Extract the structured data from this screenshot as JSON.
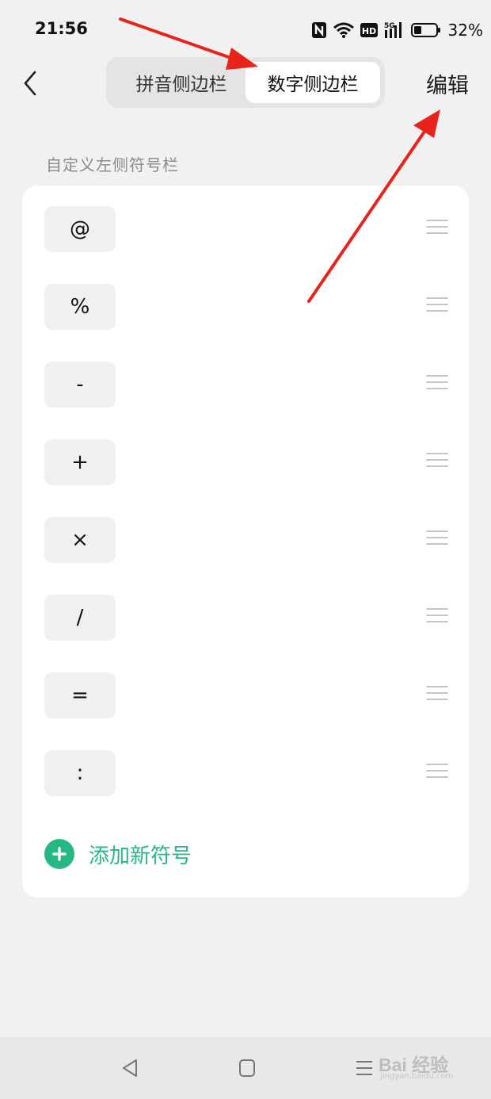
{
  "status_bar": {
    "time": "21:56",
    "battery": "32%",
    "icons": [
      "nfc-icon",
      "wifi-icon",
      "hd-icon",
      "signal-5g-icon",
      "battery-icon"
    ],
    "signal_label": "5G",
    "hd_label": "HD"
  },
  "header": {
    "tabs": [
      {
        "label": "拼音侧边栏",
        "selected": false
      },
      {
        "label": "数字侧边栏",
        "selected": true
      }
    ],
    "edit_label": "编辑"
  },
  "section_title": "自定义左侧符号栏",
  "symbols": [
    "@",
    "%",
    "-",
    "+",
    "×",
    "/",
    "=",
    ":"
  ],
  "add_symbol_label": "添加新符号",
  "watermark": {
    "text": "Bai 经验",
    "sub": "jingyan.baidu.com"
  },
  "colors": {
    "accent": "#25b883",
    "background": "#f1f1f1",
    "annotation_arrow": "#e8231c"
  }
}
